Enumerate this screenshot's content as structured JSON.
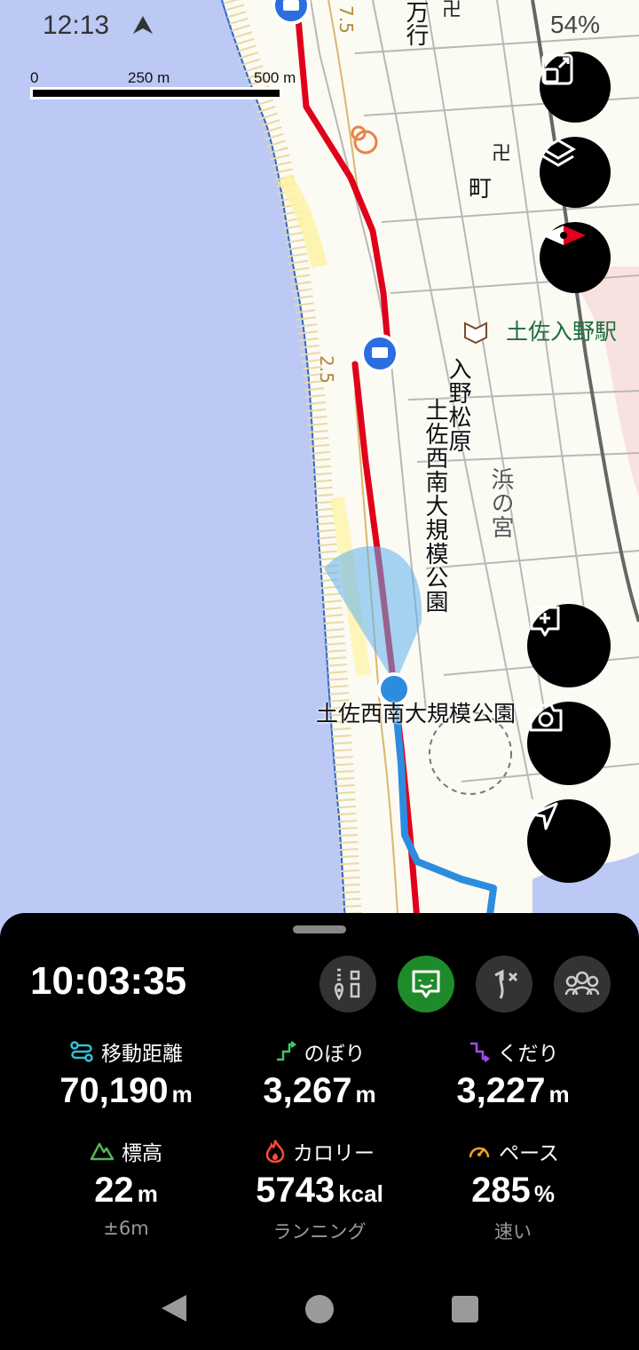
{
  "status_bar": {
    "time": "12:13",
    "battery": "54%"
  },
  "scale": {
    "label_0": "0",
    "label_mid": "250 m",
    "label_end": "500 m"
  },
  "map_labels": {
    "station": "土佐入野駅",
    "irino_matsubara": "入野松原",
    "park_vertical": "土佐西南大規模公園",
    "hamanomiya": "浜の宮",
    "town": "町",
    "area_top": "万行",
    "contour_75": "7.5",
    "contour_25": "2.5",
    "park_horizontal": "土佐西南大規模公園"
  },
  "panel": {
    "elapsed_time": "10:03:35"
  },
  "stats": {
    "distance": {
      "label": "移動距離",
      "value": "70,190",
      "unit": "m"
    },
    "ascent": {
      "label": "のぼり",
      "value": "3,267",
      "unit": "m"
    },
    "descent": {
      "label": "くだり",
      "value": "3,227",
      "unit": "m"
    },
    "elevation": {
      "label": "標高",
      "value": "22",
      "unit": "m",
      "sub": "±6m"
    },
    "calorie": {
      "label": "カロリー",
      "value": "5743",
      "unit": "kcal",
      "sub": "ランニング"
    },
    "pace": {
      "label": "ペース",
      "value": "285",
      "unit": "%",
      "sub": "速い"
    }
  },
  "colors": {
    "route_planned": "#e0001b",
    "track": "#2c8de0",
    "sea": "#bcc9f5",
    "active_control": "#1f8a2a"
  }
}
